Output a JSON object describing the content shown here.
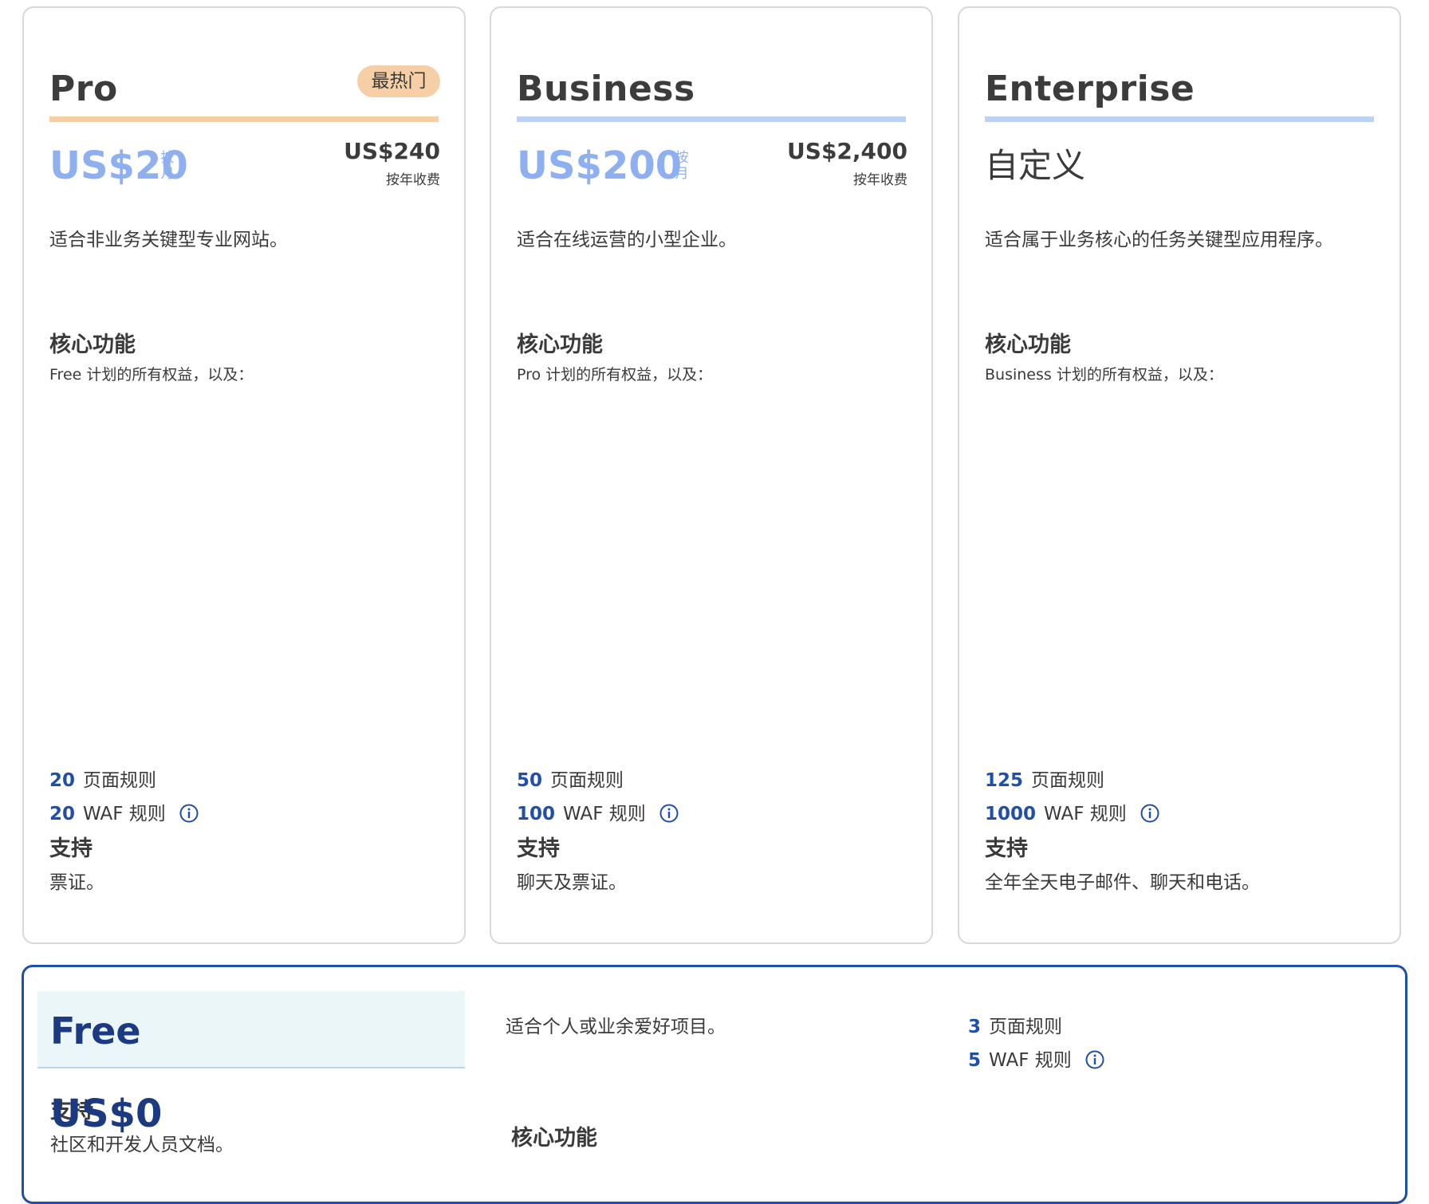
{
  "plans": {
    "pro": {
      "name": "Pro",
      "badge": "最热门",
      "price": "US$20",
      "per_month": "按月",
      "annual_price": "US$240",
      "annual_note": "按年收费",
      "description": "适合非业务关键型专业网站。",
      "core_title": "核心功能",
      "core_sub": "Free 计划的所有权益，以及：",
      "page_rules_num": "20",
      "page_rules_label": "页面规则",
      "waf_num": "20",
      "waf_label": "WAF 规则",
      "support_title": "支持",
      "support_text": "票证。"
    },
    "business": {
      "name": "Business",
      "price": "US$200",
      "per_month": "按月",
      "annual_price": "US$2,400",
      "annual_note": "按年收费",
      "description": "适合在线运营的小型企业。",
      "core_title": "核心功能",
      "core_sub": "Pro 计划的所有权益，以及：",
      "page_rules_num": "50",
      "page_rules_label": "页面规则",
      "waf_num": "100",
      "waf_label": "WAF 规则",
      "support_title": "支持",
      "support_text": "聊天及票证。"
    },
    "enterprise": {
      "name": "Enterprise",
      "price": "自定义",
      "description": "适合属于业务核心的任务关键型应用程序。",
      "core_title": "核心功能",
      "core_sub": "Business 计划的所有权益，以及：",
      "page_rules_num": "125",
      "page_rules_label": "页面规则",
      "waf_num": "1000",
      "waf_label": "WAF 规则",
      "support_title": "支持",
      "support_text": "全年全天电子邮件、聊天和电话。"
    },
    "free": {
      "name": "Free",
      "price": "US$0",
      "description": "适合个人或业余爱好项目。",
      "core_title": "核心功能",
      "page_rules_num": "3",
      "page_rules_label": "页面规则",
      "waf_num": "5",
      "waf_label": "WAF 规则",
      "support_title": "支持",
      "support_text": "社区和开发人员文档。"
    }
  },
  "colors": {
    "accent_blue": "#1f4fa8",
    "price_blue": "#8eaff0",
    "badge_orange": "#f6cfa6",
    "rule_orange": "#f5cfa8",
    "rule_blue": "#bcd1f4",
    "free_header_bg": "#ebf6f9"
  },
  "icons": {
    "info": "info-circle-icon"
  }
}
